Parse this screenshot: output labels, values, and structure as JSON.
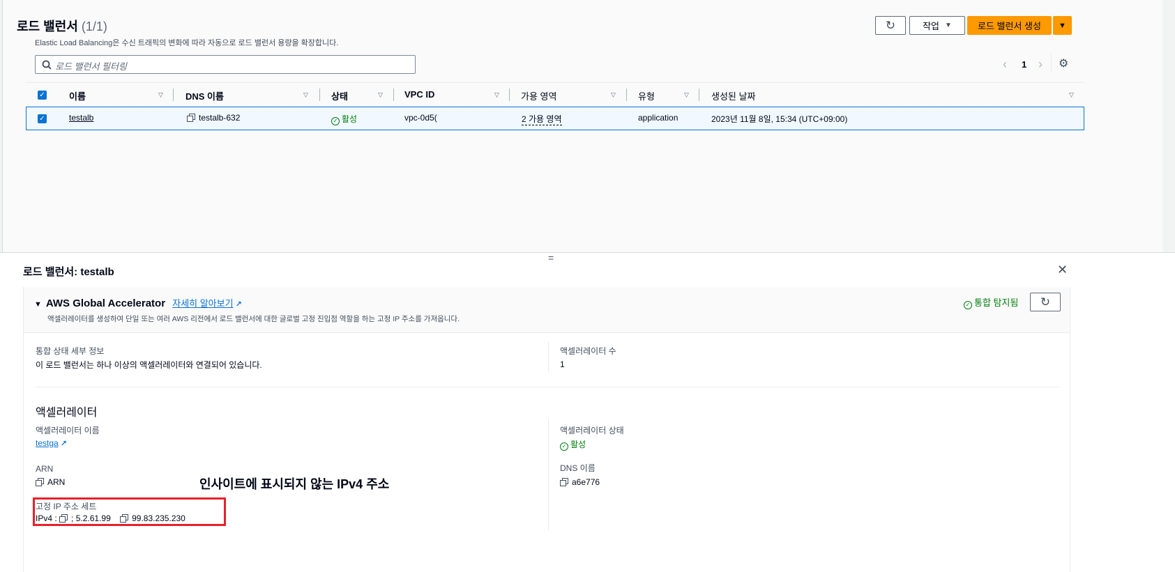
{
  "list": {
    "title": "로드 밸런서",
    "count": "(1/1)",
    "description": "Elastic Load Balancing은 수신 트래픽의 변화에 따라 자동으로 로드 밸런서 용량을 확장합니다.",
    "search_placeholder": "로드 밸런서 필터링",
    "actions_label": "작업",
    "create_label": "로드 밸런서 생성",
    "page": "1",
    "columns": [
      "이름",
      "DNS 이름",
      "상태",
      "VPC ID",
      "가용 영역",
      "유형",
      "생성된 날짜"
    ],
    "rows": [
      {
        "name": "testalb",
        "dns": "testalb-632",
        "status": "활성",
        "vpc": "vpc-0d5(",
        "az": "2 가용 영역",
        "type": "application",
        "created": "2023년 11월 8일, 15:34 (UTC+09:00)"
      }
    ]
  },
  "detail": {
    "title": "로드 밸런서: testalb",
    "ga": {
      "heading": "AWS Global Accelerator",
      "learn_more": "자세히 알아보기",
      "description": "액셀러레이터를 생성하여 단일 또는 여러 AWS 리전에서 로드 밸런서에 대한 글로벌 고정 진입점 역할을 하는 고정 IP 주소를 가져옵니다.",
      "status": "통합 탐지됨"
    },
    "integration_label": "통합 상태 세부 정보",
    "integration_value": "이 로드 밸런서는 하나 이상의 액셀러레이터와 연결되어 있습니다.",
    "accel_count_label": "액셀러레이터 수",
    "accel_count": "1",
    "accel_heading": "액셀러레이터",
    "accel_name_label": "액셀러레이터 이름",
    "accel_name": "testga",
    "accel_status_label": "액셀러레이터 상태",
    "accel_status": "활성",
    "arn_label": "ARN",
    "arn_value": "ARN",
    "dns_label": "DNS 이름",
    "dns_value": "a6e776",
    "ip_label": "고정 IP 주소 세트",
    "ip_prefix": "IPv4 :",
    "ip1": "; 5.2.61.99",
    "ip2": "99.83.235.230",
    "annotation": "인사이트에 표시되지 않는 IPv4 주소"
  }
}
